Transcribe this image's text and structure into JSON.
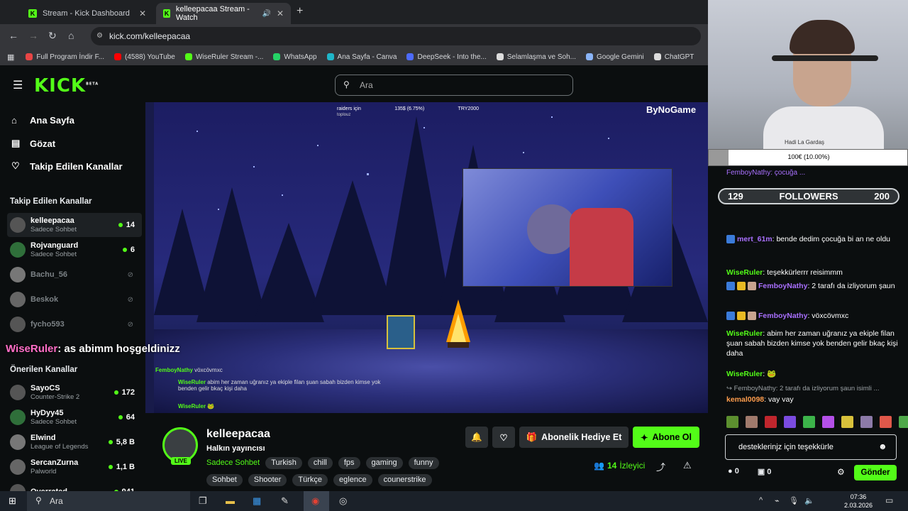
{
  "browser": {
    "tabs": [
      {
        "title": "Stream - Kick Dashboard",
        "active": false
      },
      {
        "title": "kelleepacaa Stream - Watch",
        "active": true
      }
    ],
    "new_tab": "+",
    "url": "kick.com/kelleepacaa",
    "bookmarks": [
      {
        "label": "Full Program İndir F...",
        "color": "#e84545"
      },
      {
        "label": "(4588) YouTube",
        "color": "#ff0000"
      },
      {
        "label": "WiseRuler Stream -...",
        "color": "#53fc18"
      },
      {
        "label": "WhatsApp",
        "color": "#25d366"
      },
      {
        "label": "Ana Sayfa - Canva",
        "color": "#1fb6c9"
      },
      {
        "label": "DeepSeek - Into the...",
        "color": "#4d6bfe"
      },
      {
        "label": "Selamlaşma ve Soh...",
        "color": "#dddddd"
      },
      {
        "label": "Google Gemini",
        "color": "#8ab4f8"
      },
      {
        "label": "ChatGPT",
        "color": "#dddddd"
      }
    ]
  },
  "header": {
    "logo": "KICK",
    "logo_beta": "BETA",
    "search_placeholder": "Ara"
  },
  "sidebar": {
    "nav": [
      {
        "label": "Ana Sayfa",
        "icon": "home-icon"
      },
      {
        "label": "Gözat",
        "icon": "browse-icon"
      },
      {
        "label": "Takip Edilen Kanallar",
        "icon": "heart-icon"
      }
    ],
    "followed_title": "Takip Edilen Kanallar",
    "followed": [
      {
        "name": "kelleepacaa",
        "sub": "Sadece Sohbet",
        "count": "14",
        "live": true
      },
      {
        "name": "Rojvanguard",
        "sub": "Sadece Sohbet",
        "count": "6",
        "live": true
      },
      {
        "name": "Bachu_56",
        "sub": "",
        "count": "",
        "live": false
      },
      {
        "name": "Beskok",
        "sub": "",
        "count": "",
        "live": false
      },
      {
        "name": "fycho593",
        "sub": "",
        "count": "",
        "live": false
      }
    ],
    "recommended_title": "Önerilen Kanallar",
    "recommended": [
      {
        "name": "SayoCS",
        "sub": "Counter-Strike 2",
        "count": "172"
      },
      {
        "name": "HyDyy45",
        "sub": "Sadece Sohbet",
        "count": "64"
      },
      {
        "name": "Elwind",
        "sub": "League of Legends",
        "count": "5,8 B"
      },
      {
        "name": "SercanZurna",
        "sub": "Palworld",
        "count": "1,1 B"
      },
      {
        "name": "Overrated",
        "sub": "",
        "count": "941"
      }
    ]
  },
  "overlay": {
    "user": "WiseRuler",
    "text": ": as abimm hoşgeldinizz"
  },
  "video": {
    "watermark": "ByNoGame",
    "goal_label": "raiders için",
    "goal_sub": "toplouz",
    "goal_progress": "135$ (6.75%)",
    "goal_target": "TRY2000",
    "chat_lines": [
      {
        "user": "FemboyNathy",
        "text": "vöxcövmxc"
      },
      {
        "user": "WiseRuler",
        "text": "abim her zaman uğranız ya ekiple filan şuan sabah bizden kimse yok benden gelir bkaç kişi daha"
      },
      {
        "user": "WiseRuler",
        "text": "🐸"
      }
    ]
  },
  "channel": {
    "name": "kelleepacaa",
    "live": "LIVE",
    "title": "Halkın yayıncısı",
    "category": "Sadece Sohbet",
    "tags_row1": [
      "Turkish",
      "chill",
      "fps",
      "gaming",
      "funny"
    ],
    "tags_row2": [
      "Sohbet",
      "Shooter",
      "Türkçe",
      "eglence",
      "counerstrike"
    ],
    "gift_label": "Abonelik Hediye Et",
    "subscribe_label": "Abone Ol",
    "viewers": "14",
    "viewers_label": "İzleyici"
  },
  "webcam": {
    "caption": "Hadi La Gardaş",
    "goal_text": "100€ (10.00%)"
  },
  "chat": {
    "followers_current": "129",
    "followers_label": "FOLLOWERS",
    "followers_goal": "200",
    "top_line": "FemboyNathy: çocuğa ...",
    "messages": [
      {
        "user": "mert_61m",
        "color": "#a970ff",
        "text": "bende dedim çocuğa bi an ne oldu"
      },
      {
        "user": "WiseRuler",
        "color": "#53fc18",
        "text": "teşekkürlerrr reisimmm"
      },
      {
        "user": "FemboyNathy",
        "color": "#a970ff",
        "text": "2 tarafı da izliyorum şaun"
      },
      {
        "user": "FemboyNathy",
        "color": "#a970ff",
        "text": "vöxcövmxc"
      },
      {
        "user": "WiseRuler",
        "color": "#53fc18",
        "text": "abim her zaman uğranız ya ekiple filan şuan sabah bizden kimse yok benden gelir bkaç kişi daha"
      },
      {
        "user": "WiseRuler",
        "color": "#53fc18",
        "text": "🐸"
      }
    ],
    "reply_context": "FemboyNathy: 2 tarafı da izliyorum şaun isimli ...",
    "last_user": "kemal0098",
    "last_text": "vay vay",
    "input_value": "desteklerinjz için teşekkürle",
    "points_a": "0",
    "points_b": "0",
    "send_label": "Gönder"
  },
  "taskbar": {
    "search": "Ara",
    "time": "07:36",
    "date": "2.03.2026"
  }
}
